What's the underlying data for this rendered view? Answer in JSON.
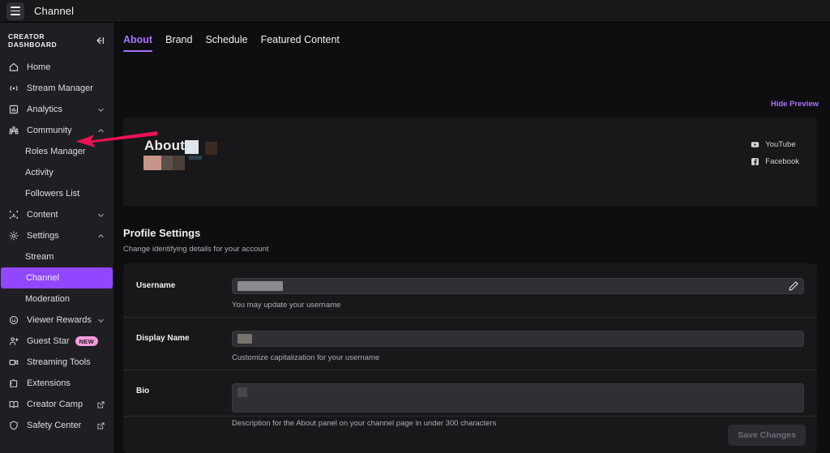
{
  "topbar": {
    "menu_icon": "hamburger-icon",
    "title": "Channel"
  },
  "sidebar": {
    "header_title": "CREATOR DASHBOARD",
    "collapse_icon": "collapse-left-icon",
    "items": [
      {
        "label": "Home",
        "icon": "home-icon",
        "type": "link"
      },
      {
        "label": "Stream Manager",
        "icon": "broadcast-icon",
        "type": "link"
      },
      {
        "label": "Analytics",
        "icon": "chart-icon",
        "type": "group",
        "chevron": "chevron-down-icon"
      },
      {
        "label": "Community",
        "icon": "community-icon",
        "type": "group",
        "chevron": "chevron-up-icon"
      },
      {
        "label": "Roles Manager",
        "type": "sub"
      },
      {
        "label": "Activity",
        "type": "sub"
      },
      {
        "label": "Followers List",
        "type": "sub"
      },
      {
        "label": "Content",
        "icon": "content-icon",
        "type": "group",
        "chevron": "chevron-down-icon"
      },
      {
        "label": "Settings",
        "icon": "gear-icon",
        "type": "group",
        "chevron": "chevron-up-icon"
      },
      {
        "label": "Stream",
        "type": "sub"
      },
      {
        "label": "Channel",
        "type": "sub",
        "active": true
      },
      {
        "label": "Moderation",
        "type": "sub"
      },
      {
        "label": "Viewer Rewards",
        "icon": "rewards-icon",
        "type": "group",
        "chevron": "chevron-down-icon"
      },
      {
        "label": "Guest Star",
        "icon": "guest-star-icon",
        "type": "link",
        "badge": "NEW"
      },
      {
        "label": "Streaming Tools",
        "icon": "camera-icon",
        "type": "link"
      },
      {
        "label": "Extensions",
        "icon": "extensions-icon",
        "type": "link"
      },
      {
        "label": "Creator Camp",
        "icon": "book-icon",
        "type": "link",
        "external": "external-link-icon"
      },
      {
        "label": "Safety Center",
        "icon": "shield-icon",
        "type": "link",
        "external": "external-link-icon"
      }
    ],
    "active_color": "#9147ff",
    "badge_color": "#f49ade"
  },
  "main": {
    "tabs": [
      {
        "label": "About",
        "active": true
      },
      {
        "label": "Brand",
        "active": false
      },
      {
        "label": "Schedule",
        "active": false
      },
      {
        "label": "Featured Content",
        "active": false
      }
    ],
    "hide_preview_label": "Hide Preview",
    "accent_color": "#a970ff",
    "preview": {
      "heading_word": "About",
      "socials": [
        {
          "label": "YouTube",
          "icon": "youtube-icon"
        },
        {
          "label": "Facebook",
          "icon": "facebook-icon"
        }
      ]
    },
    "profile_settings": {
      "title": "Profile Settings",
      "subtitle": "Change identifying details for your account",
      "fields": [
        {
          "label": "Username",
          "value": "",
          "helper": "You may update your username",
          "edit_icon": "pencil-icon"
        },
        {
          "label": "Display Name",
          "value": "",
          "helper": "Customize capitalization for your username"
        },
        {
          "label": "Bio",
          "value": "",
          "helper": "Description for the About panel on your channel page in under 300 characters"
        }
      ],
      "save_label": "Save Changes"
    }
  },
  "annotation": {
    "arrow_color": "#ee1155",
    "points_to": "Roles Manager"
  }
}
